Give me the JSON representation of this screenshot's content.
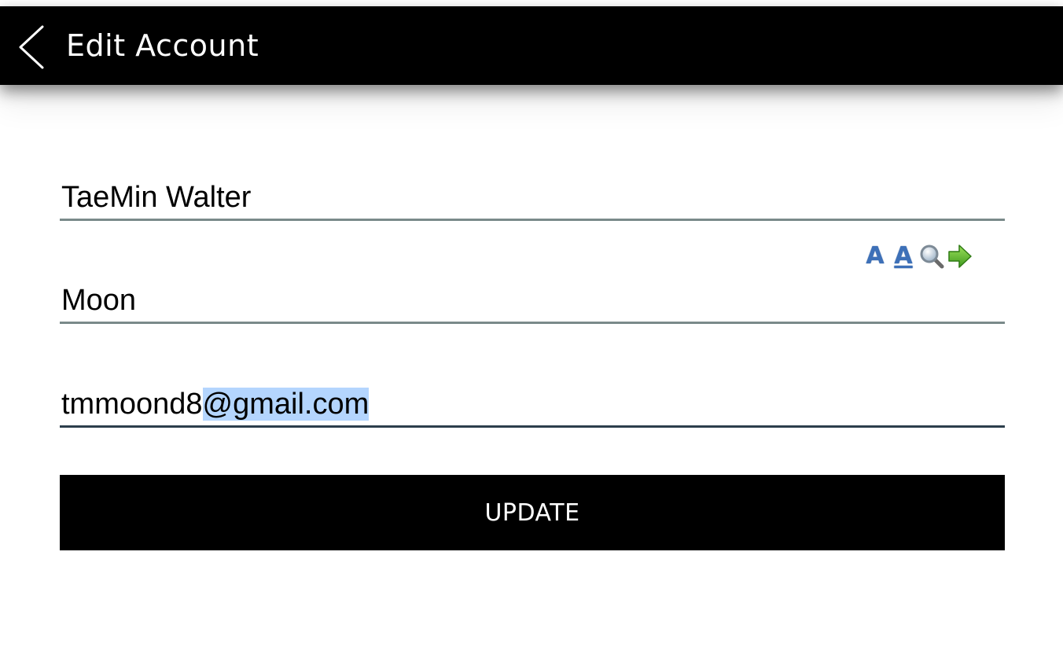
{
  "header": {
    "title": "Edit Account",
    "back_icon": "chevron-left-icon"
  },
  "form": {
    "first_name": "TaeMin Walter",
    "last_name": "Moon",
    "email_prefix": "tmmoond8",
    "email_selected": "@gmail.com"
  },
  "toolbar": {
    "icons": [
      "font-size-icon",
      "font-underline-icon",
      "magnifier-icon",
      "arrow-right-icon"
    ],
    "letter_a": "A",
    "letter_a_underlined": "A"
  },
  "actions": {
    "update_label": "UPDATE"
  },
  "colors": {
    "header_bg": "#000000",
    "button_bg": "#000000",
    "selection": "#b4d5fe",
    "underline": "#7a8a8a",
    "underline_focused": "#2c3e4c",
    "icon_blue": "#3d70b8",
    "icon_green": "#5cb82c"
  }
}
